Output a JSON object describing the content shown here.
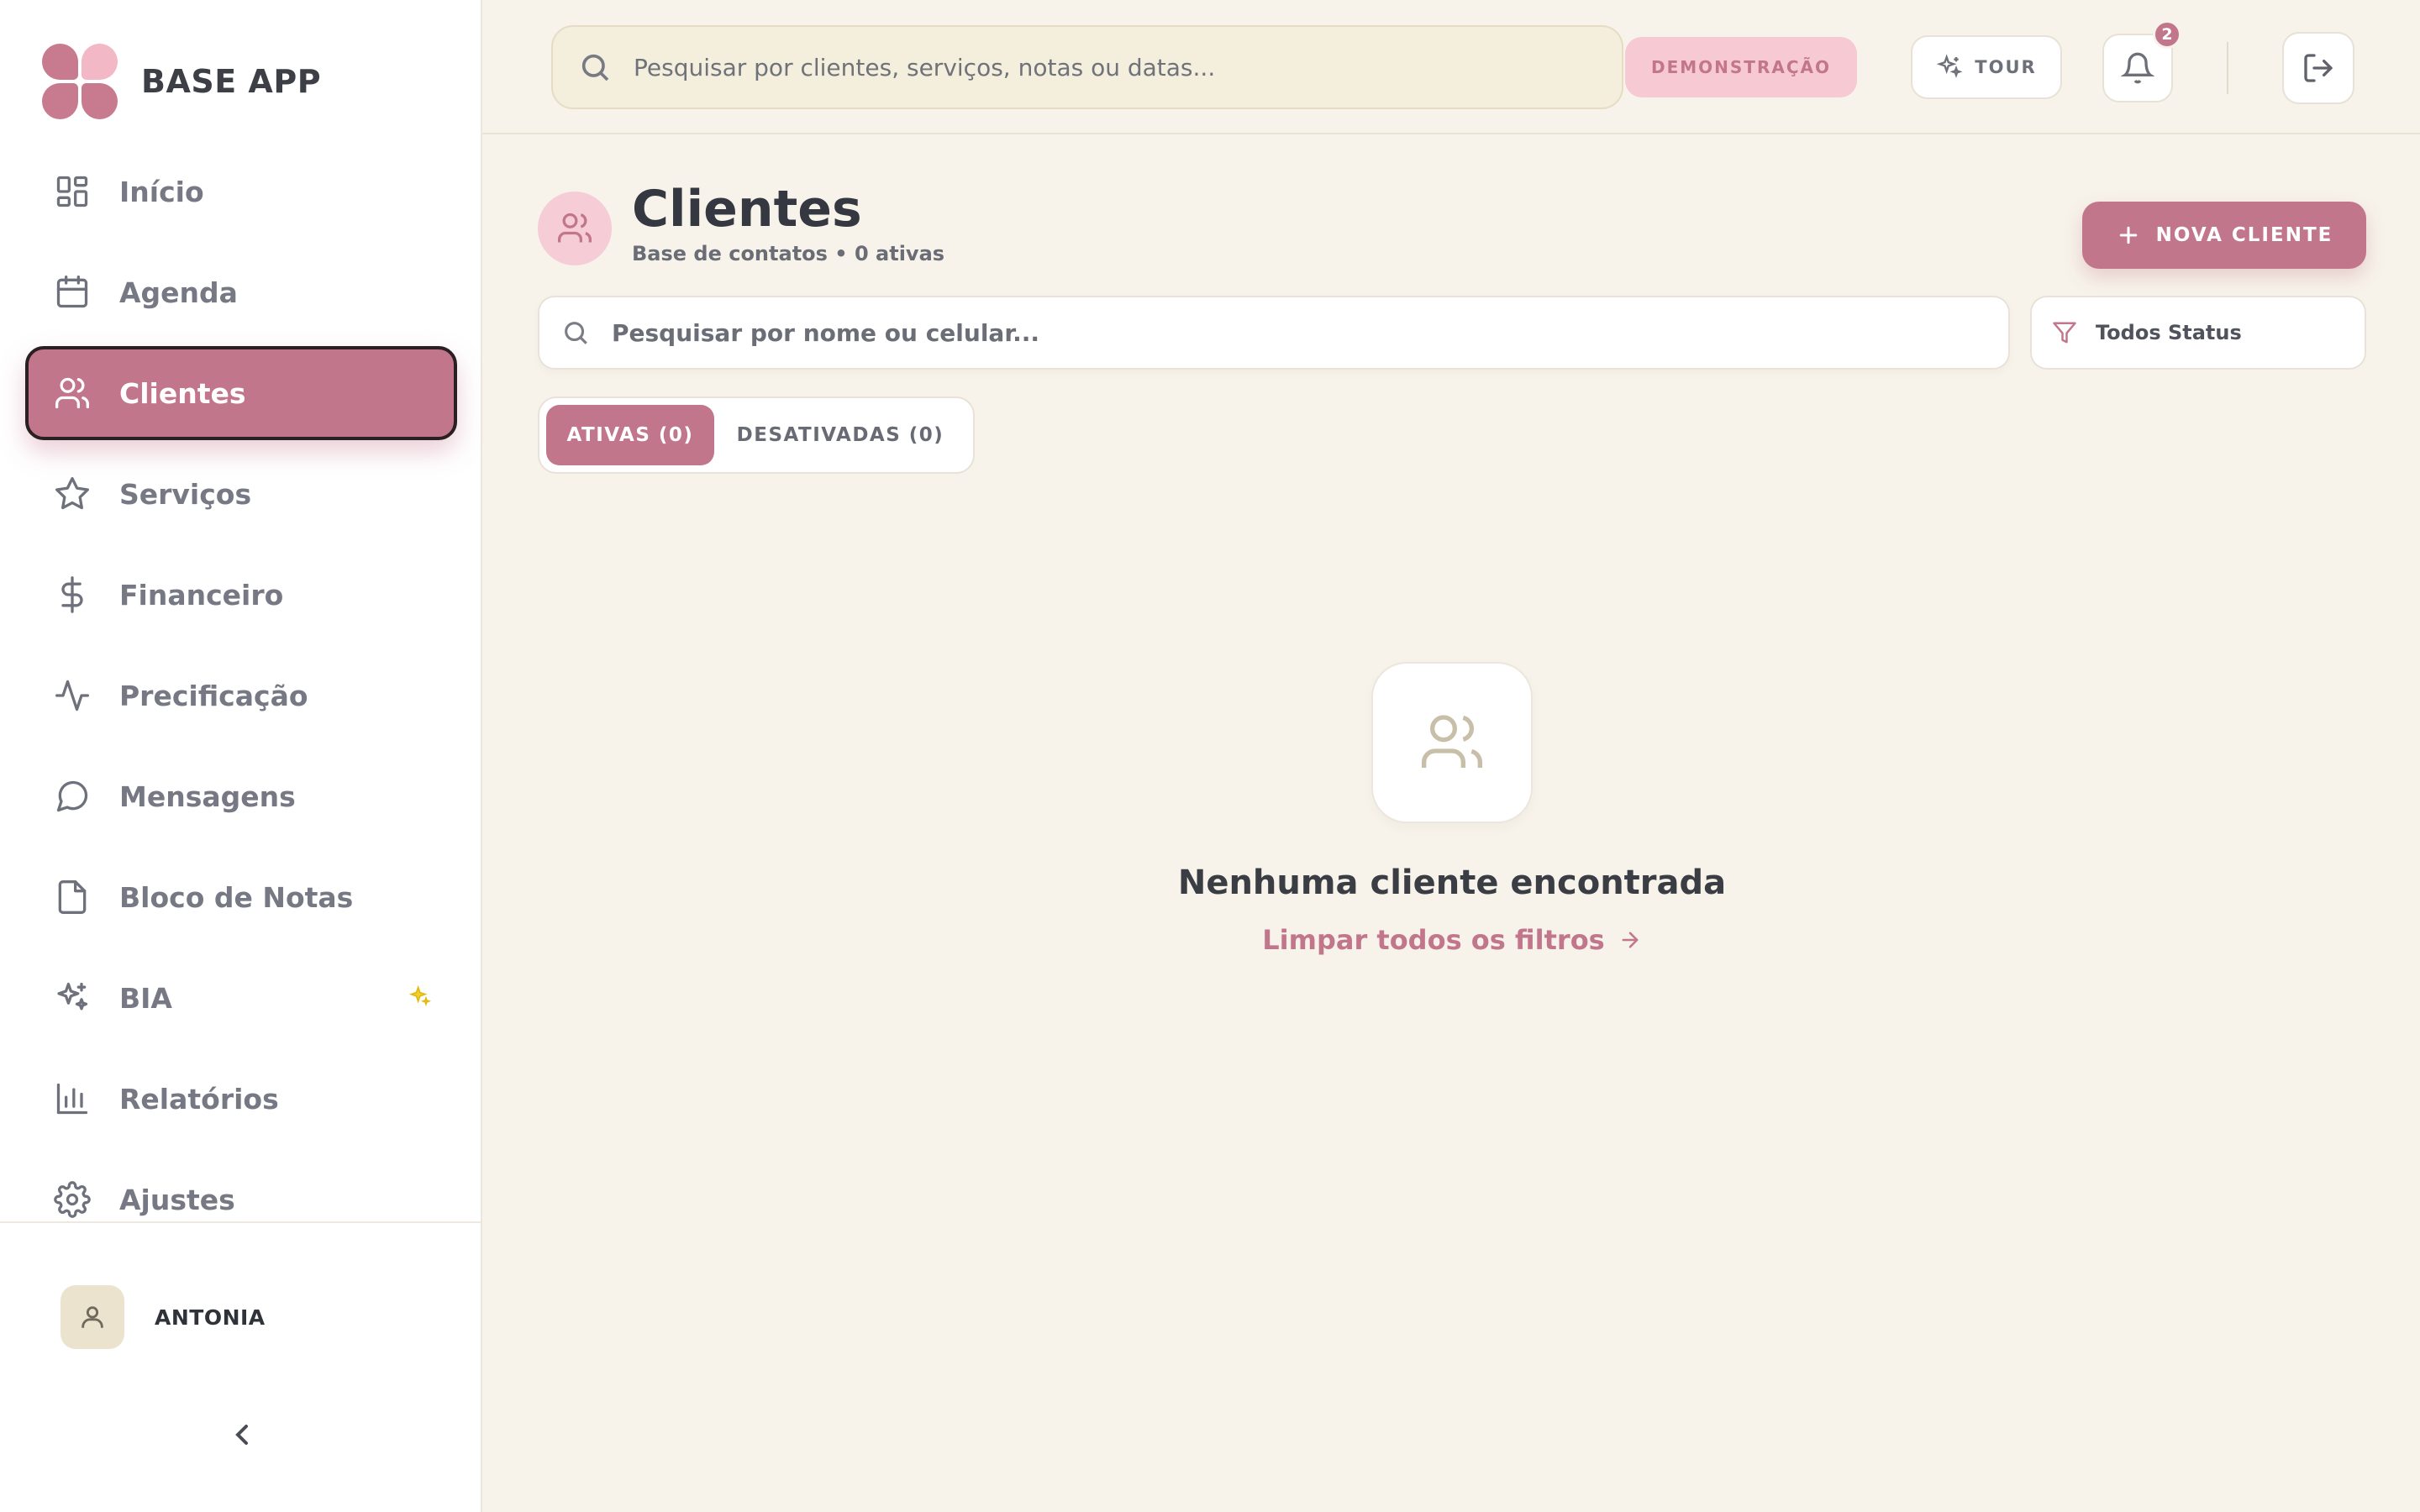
{
  "app": {
    "name": "BASE APP"
  },
  "sidebar": {
    "items": [
      {
        "label": "Início",
        "icon": "grid-icon"
      },
      {
        "label": "Agenda",
        "icon": "calendar-icon"
      },
      {
        "label": "Clientes",
        "icon": "users-icon",
        "active": true
      },
      {
        "label": "Serviços",
        "icon": "star-icon"
      },
      {
        "label": "Financeiro",
        "icon": "dollar-icon"
      },
      {
        "label": "Precificação",
        "icon": "activity-icon"
      },
      {
        "label": "Mensagens",
        "icon": "message-icon"
      },
      {
        "label": "Bloco de Notas",
        "icon": "file-icon"
      },
      {
        "label": "BIA",
        "icon": "sparkles-icon"
      },
      {
        "label": "Relatórios",
        "icon": "bar-chart-icon"
      },
      {
        "label": "Ajustes",
        "icon": "gear-icon"
      }
    ],
    "user": {
      "name": "ANTONIA"
    }
  },
  "header": {
    "search_placeholder": "Pesquisar por clientes, serviços, notas ou datas...",
    "demo_label": "DEMONSTRAÇÃO",
    "tour_label": "TOUR",
    "notification_count": "2"
  },
  "main": {
    "title": "Clientes",
    "subtitle": "Base de contatos • 0 ativas",
    "new_button": "NOVA CLIENTE",
    "search_placeholder": "Pesquisar por nome ou celular...",
    "status_filter": "Todos Status",
    "tabs": [
      {
        "label": "ATIVAS (0)",
        "active": true
      },
      {
        "label": "DESATIVADAS (0)",
        "active": false
      }
    ],
    "empty_title": "Nenhuma cliente encontrada",
    "clear_filters": "Limpar todos os filtros"
  },
  "colors": {
    "accent": "#c2768b",
    "accent_light": "#f6cdd6",
    "background": "#f7f3ea",
    "sparkle": "#f1d22c"
  }
}
